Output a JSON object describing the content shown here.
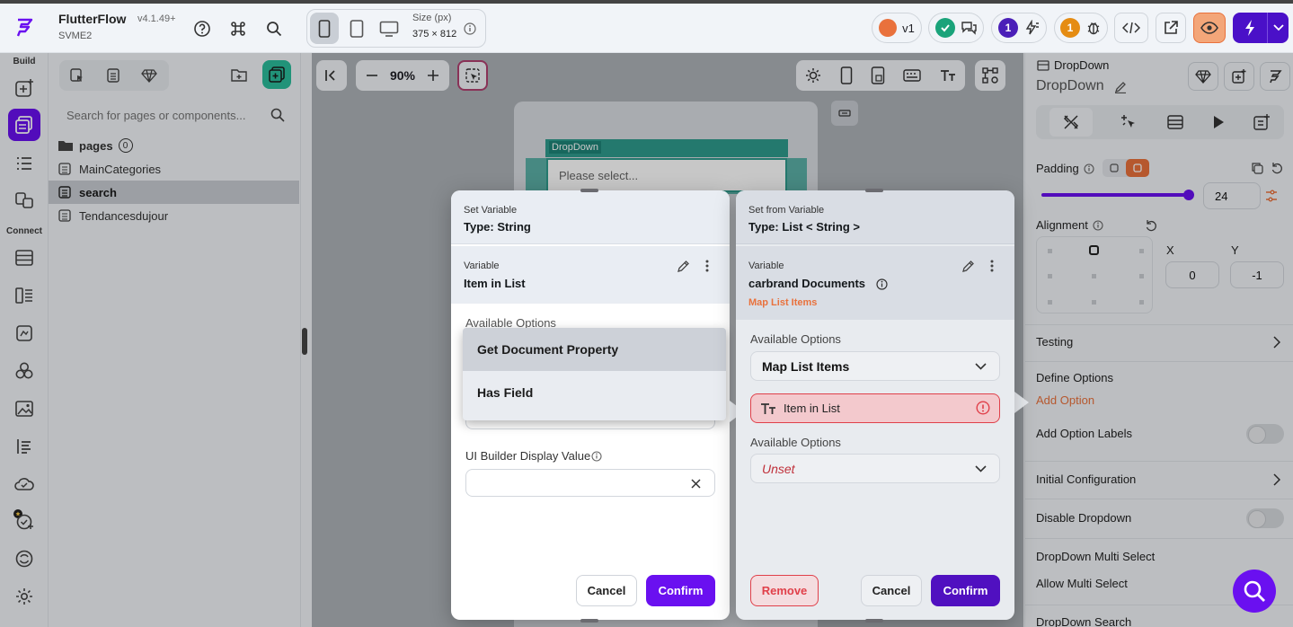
{
  "header": {
    "app_name": "FlutterFlow",
    "version": "v4.1.49+",
    "project": "SVME2",
    "size_label": "Size (px)",
    "size_value": "375 × 812",
    "version_badge": "v1",
    "badge_count_1": "1",
    "badge_count_2": "1"
  },
  "rail": {
    "build_label": "Build",
    "connect_label": "Connect"
  },
  "tree": {
    "search_placeholder": "Search for pages or components...",
    "pages_label": "pages",
    "pages_count": "0",
    "pages": [
      "MainCategories",
      "search",
      "Tendancesdujour"
    ]
  },
  "canvas": {
    "zoom": "90%",
    "dropdown_tag": "DropDown",
    "dropdown_placeholder": "Please select..."
  },
  "props": {
    "title": "DropDown",
    "subtitle": "DropDown",
    "padding_label": "Padding",
    "padding_value": "24",
    "alignment_label": "Alignment",
    "x_label": "X",
    "y_label": "Y",
    "x_value": "0",
    "y_value": "-1",
    "testing": "Testing",
    "define_options": "Define Options",
    "add_option": "Add Option",
    "add_option_labels": "Add Option Labels",
    "initial_configuration": "Initial Configuration",
    "disable_dropdown": "Disable Dropdown",
    "multi_select": "DropDown Multi Select",
    "allow_multi_select": "Allow Multi Select",
    "dropdown_search": "DropDown Search"
  },
  "dialog_left": {
    "header_small": "Set Variable",
    "header_type": "Type: String",
    "variable_label": "Variable",
    "variable_value": "Item in List",
    "available_options_label": "Available Options",
    "menu_items": [
      "Get Document Property",
      "Has Field"
    ],
    "display_value_label": "UI Builder Display Value",
    "cancel": "Cancel",
    "confirm": "Confirm"
  },
  "dialog_right": {
    "header_small": "Set from Variable",
    "header_type": "Type: List < String >",
    "variable_label": "Variable",
    "variable_value": "carbrand Documents",
    "variable_sub": "Map List Items",
    "options_label_1": "Available Options",
    "options_value_1": "Map List Items",
    "item_in_list": "Item in List",
    "options_label_2": "Available Options",
    "options_value_2": "Unset",
    "remove": "Remove",
    "cancel": "Cancel",
    "confirm": "Confirm"
  },
  "colors": {
    "accent": "#6a10f0",
    "error": "#e0404a",
    "link_orange": "#e9713c",
    "dim_error_bg": "#f9d5d8"
  }
}
